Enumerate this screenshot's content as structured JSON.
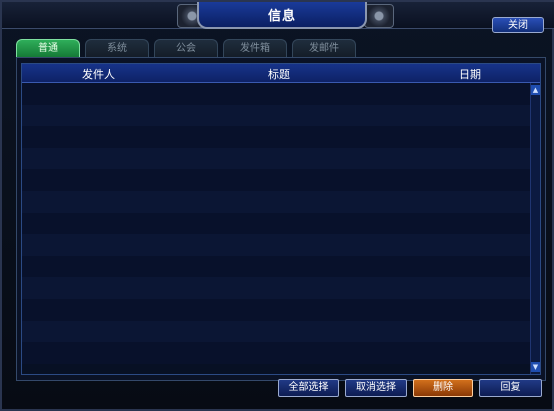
{
  "window": {
    "title": "信息",
    "close_label": "关闭"
  },
  "tabs": [
    {
      "label": "普通",
      "active": true
    },
    {
      "label": "系统",
      "active": false
    },
    {
      "label": "公会",
      "active": false
    },
    {
      "label": "发件箱",
      "active": false
    },
    {
      "label": "发邮件",
      "active": false
    }
  ],
  "list": {
    "columns": {
      "sender": "发件人",
      "subject": "标题",
      "date": "日期"
    },
    "rows": []
  },
  "actions": {
    "select_all": "全部选择",
    "deselect": "取消选择",
    "delete": "删除",
    "reply": "回复"
  },
  "icons": {
    "scroll_up": "triangle-up-icon",
    "scroll_down": "triangle-down-icon"
  },
  "colors": {
    "active_tab": "#1f8f45",
    "delete_button": "#b85a12",
    "header_blue": "#17338a"
  }
}
